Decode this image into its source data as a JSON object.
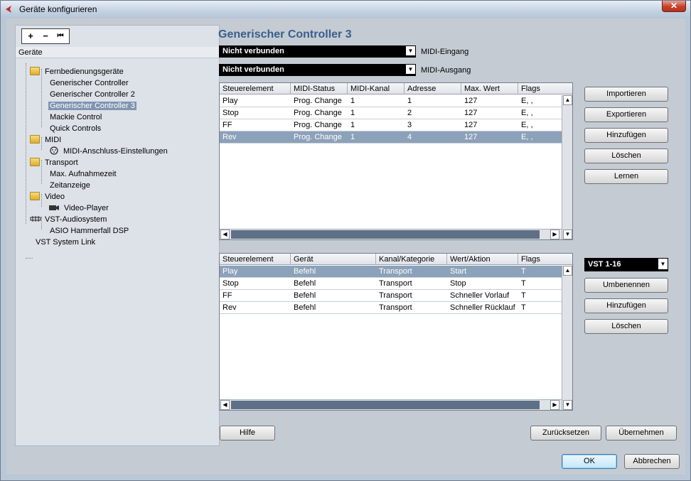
{
  "window": {
    "title": "Geräte konfigurieren",
    "close_symbol": "✕"
  },
  "toolbar": {
    "add": "+",
    "remove": "−",
    "first": "⏮"
  },
  "tree": {
    "header": "Geräte",
    "items": [
      {
        "label": "Fernbedienungsgeräte",
        "icon": "folder-icon"
      },
      {
        "label": "Generischer Controller"
      },
      {
        "label": "Generischer Controller 2"
      },
      {
        "label": "Generischer Controller 3",
        "selected": true
      },
      {
        "label": "Mackie Control"
      },
      {
        "label": "Quick Controls"
      },
      {
        "label": "MIDI",
        "icon": "folder-icon"
      },
      {
        "label": "MIDI-Anschluss-Einstellungen",
        "icon": "midi-port-icon"
      },
      {
        "label": "Transport",
        "icon": "folder-icon"
      },
      {
        "label": "Max. Aufnahmezeit"
      },
      {
        "label": "Zeitanzeige"
      },
      {
        "label": "Video",
        "icon": "folder-icon"
      },
      {
        "label": "Video-Player",
        "icon": "video-icon"
      },
      {
        "label": "VST-Audiosystem",
        "icon": "audio-system-icon"
      },
      {
        "label": "ASIO Hammerfall DSP"
      },
      {
        "label": "VST System Link"
      }
    ]
  },
  "main": {
    "title": "Generischer Controller 3",
    "midi_in": {
      "value": "Nicht verbunden",
      "label": "MIDI-Eingang"
    },
    "midi_out": {
      "value": "Nicht verbunden",
      "label": "MIDI-Ausgang"
    },
    "table1": {
      "headers": [
        "Steuerelement",
        "MIDI-Status",
        "MIDI-Kanal",
        "Adresse",
        "Max. Wert",
        "Flags"
      ],
      "rows": [
        [
          "Play",
          "Prog. Change",
          "1",
          "1",
          "127",
          "E, ,"
        ],
        [
          "Stop",
          "Prog. Change",
          "1",
          "2",
          "127",
          "E, ,"
        ],
        [
          "FF",
          "Prog. Change",
          "1",
          "3",
          "127",
          "E, ,"
        ],
        [
          "Rev",
          "Prog. Change",
          "1",
          "4",
          "127",
          "E, ,"
        ]
      ],
      "selected_row": 3
    },
    "table2": {
      "headers": [
        "Steuerelement",
        "Gerät",
        "Kanal/Kategorie",
        "Wert/Aktion",
        "Flags"
      ],
      "rows": [
        [
          "Play",
          "Befehl",
          "Transport",
          "Start",
          "T"
        ],
        [
          "Stop",
          "Befehl",
          "Transport",
          "Stop",
          "T"
        ],
        [
          "FF",
          "Befehl",
          "Transport",
          "Schneller Vorlauf",
          "T"
        ],
        [
          "Rev",
          "Befehl",
          "Transport",
          "Schneller Rücklauf",
          "T"
        ]
      ],
      "selected_row": 0
    },
    "buttons1": {
      "import": "Importieren",
      "export": "Exportieren",
      "add": "Hinzufügen",
      "delete": "Löschen",
      "learn": "Lernen"
    },
    "bank_select": "VST 1-16",
    "buttons2": {
      "rename": "Umbenennen",
      "add": "Hinzufügen",
      "delete": "Löschen"
    },
    "help": "Hilfe",
    "reset": "Zurücksetzen",
    "apply": "Übernehmen"
  },
  "footer": {
    "ok": "OK",
    "cancel": "Abbrechen"
  },
  "scroll": {
    "up": "▲",
    "down": "▼",
    "left": "◀",
    "right": "▶"
  }
}
